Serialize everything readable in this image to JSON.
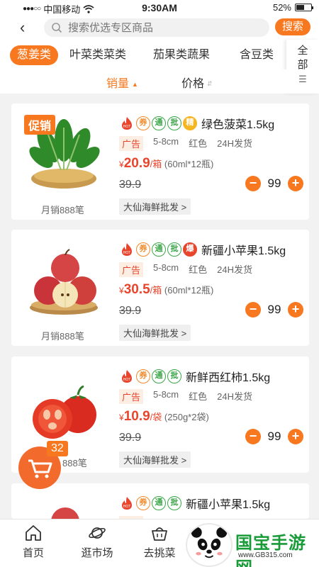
{
  "status_bar": {
    "carrier": "中国移动",
    "time": "9:30AM",
    "battery": "52%"
  },
  "search": {
    "placeholder": "搜索优选专区商品",
    "button": "搜索"
  },
  "categories": [
    {
      "label": "葱姜类",
      "active": true
    },
    {
      "label": "叶菜类菜类",
      "active": false
    },
    {
      "label": "茄果类蔬果",
      "active": false
    },
    {
      "label": "含豆类",
      "active": false
    }
  ],
  "all_categories_label": "全部",
  "sort": {
    "sales": "销量",
    "price": "价格"
  },
  "products": [
    {
      "promo": "促销",
      "badges": [
        "券",
        "通",
        "批",
        "精"
      ],
      "name": "绿色菠菜1.5kg",
      "ad": "广告",
      "size": "5-8cm",
      "color": "红色",
      "ship": "24H发货",
      "currency": "¥",
      "price": "20.9",
      "unit": "/箱",
      "pack": "(60ml*12瓶)",
      "old_price": "39.9",
      "qty": "99",
      "shop": "大仙海鲜批发 >",
      "monthly": "月销888笔"
    },
    {
      "promo": "",
      "badges": [
        "券",
        "通",
        "批",
        "爆"
      ],
      "name": "新疆小苹果1.5kg",
      "ad": "广告",
      "size": "5-8cm",
      "color": "红色",
      "ship": "24H发货",
      "currency": "¥",
      "price": "30.5",
      "unit": "/箱",
      "pack": "(60ml*12瓶)",
      "old_price": "39.9",
      "qty": "99",
      "shop": "大仙海鲜批发 >",
      "monthly": "月销888笔"
    },
    {
      "promo": "",
      "badges": [
        "券",
        "通",
        "批"
      ],
      "name": "新鲜西红柿1.5kg",
      "ad": "广告",
      "size": "5-8cm",
      "color": "红色",
      "ship": "24H发货",
      "currency": "¥",
      "price": "10.9",
      "unit": "/袋",
      "pack": "(250g*2袋)",
      "old_price": "39.9",
      "qty": "99",
      "shop": "大仙海鲜批发 >",
      "monthly": "888笔"
    },
    {
      "promo": "",
      "badges": [
        "券",
        "通",
        "批"
      ],
      "name": "新疆小苹果1.5kg",
      "ad": "广告"
    }
  ],
  "cart": {
    "count": "32"
  },
  "tabs": [
    "首页",
    "逛市场",
    "去挑菜"
  ],
  "watermark": {
    "text": "国宝手游网",
    "url": "www.GB315.com"
  },
  "colors": {
    "accent": "#f7781f",
    "price": "#e8452c",
    "green": "#3aa648"
  }
}
